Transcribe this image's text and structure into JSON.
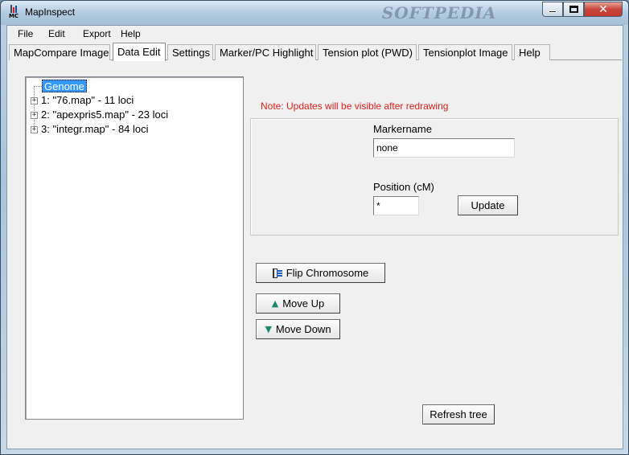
{
  "window": {
    "title": "MapInspect",
    "icon_caption": "MC",
    "watermark": "SOFTPEDIA",
    "controls": [
      "minimize",
      "maximize",
      "close"
    ]
  },
  "menu": {
    "items": [
      "File",
      "Edit",
      "Export",
      "Help"
    ]
  },
  "tabs": {
    "items": [
      "MapCompare Image",
      "Data Edit",
      "Settings",
      "Marker/PC Highlight",
      "Tension plot (PWD)",
      "Tensionplot Image",
      "Help"
    ],
    "active": "Data Edit"
  },
  "tree": {
    "root": "Genome",
    "nodes": [
      {
        "label": "1: \"76.map\" - 11 loci",
        "expander": "+"
      },
      {
        "label": "2: \"apexpris5.map\" - 23 loci",
        "expander": "+"
      },
      {
        "label": "3: \"integr.map\" - 84 loci",
        "expander": "+"
      }
    ]
  },
  "editor": {
    "note": "Note: Updates will be visible after redrawing",
    "markername_label": "Markername",
    "markername_value": "none",
    "position_label": "Position (cM)",
    "position_value": "*",
    "update_label": "Update"
  },
  "actions": {
    "flip_label": "Flip Chromosome",
    "move_up_label": "Move Up",
    "move_down_label": "Move Down",
    "refresh_label": "Refresh tree"
  },
  "colors": {
    "note": "#e02020",
    "selection": "#3399ff",
    "arrow_icon": "#1a8a6a"
  }
}
